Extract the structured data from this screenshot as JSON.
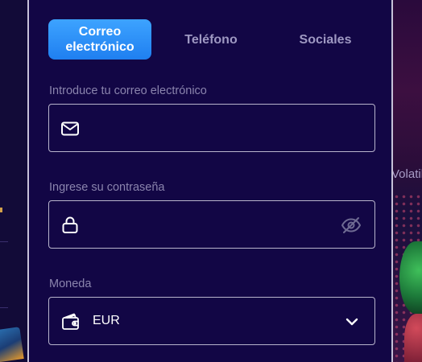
{
  "background": {
    "right_fragment_text": "Volatil"
  },
  "tabs": [
    {
      "label": "Correo electrónico",
      "active": true
    },
    {
      "label": "Teléfono",
      "active": false
    },
    {
      "label": "Sociales",
      "active": false
    }
  ],
  "email_field": {
    "label": "Introduce tu correo electrónico",
    "value": "",
    "placeholder": "",
    "icon": "mail-icon"
  },
  "password_field": {
    "label": "Ingrese su contraseña",
    "value": "",
    "placeholder": "",
    "icon": "lock-icon",
    "toggle_icon": "eye-off-icon"
  },
  "currency_field": {
    "label": "Moneda",
    "selected": "EUR",
    "icon": "wallet-icon",
    "dropdown_icon": "chevron-down-icon"
  },
  "colors": {
    "panel_bg": "#120645",
    "accent": "#2a8ef8",
    "label": "#8a84ad",
    "border": "#b8b4cc",
    "text": "#ffffff"
  }
}
